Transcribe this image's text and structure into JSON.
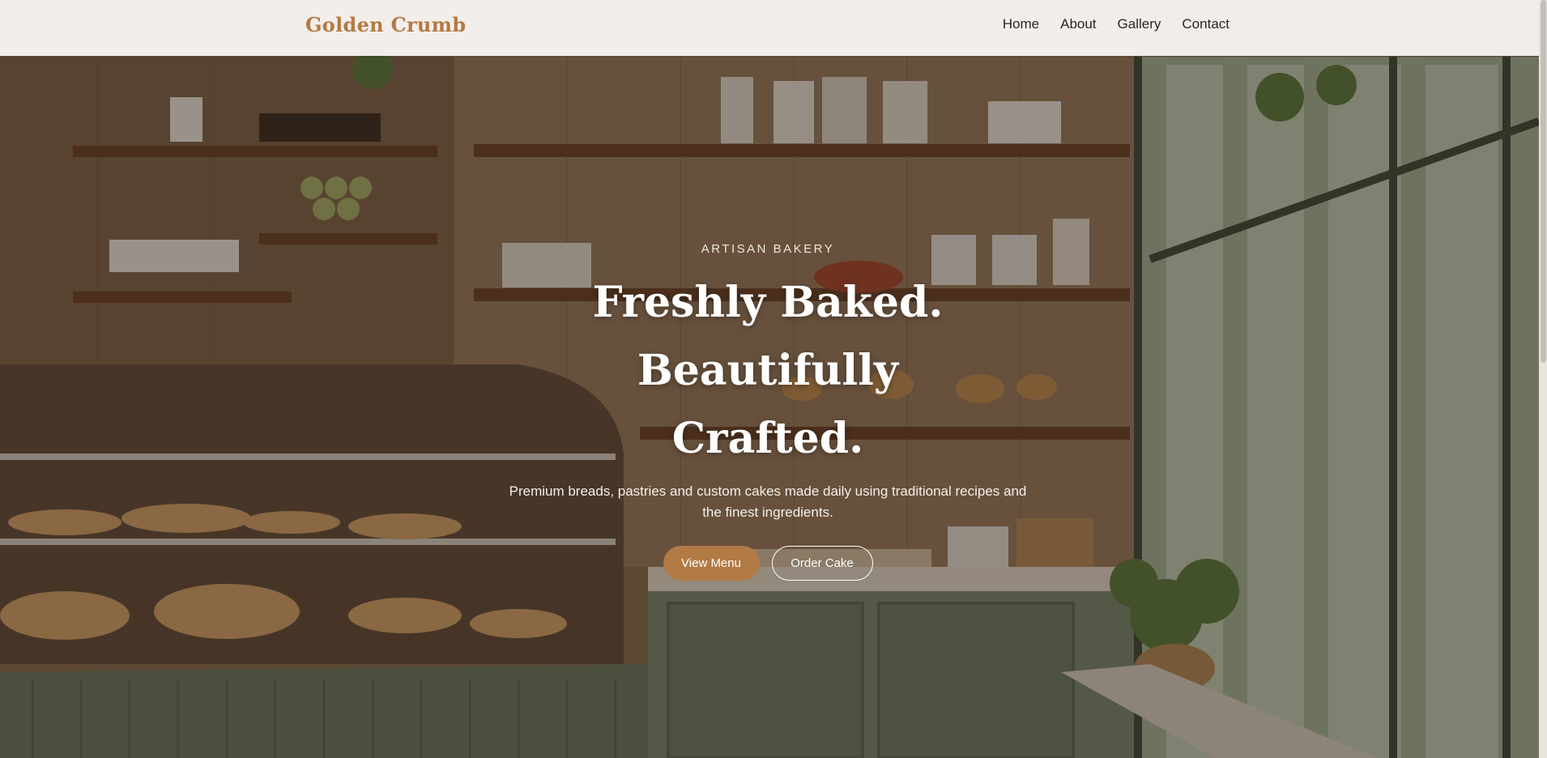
{
  "brand": {
    "name": "Golden Crumb",
    "color": "#b27a45"
  },
  "nav": {
    "items": [
      {
        "label": "Home"
      },
      {
        "label": "About"
      },
      {
        "label": "Gallery"
      },
      {
        "label": "Contact"
      }
    ]
  },
  "hero": {
    "eyebrow": "ARTISAN BAKERY",
    "title_line1": "Freshly Baked. Beautifully",
    "title_line2": "Crafted.",
    "subtitle_line1": "Premium breads, pastries and custom cakes made daily using traditional recipes and",
    "subtitle_line2": "the finest ingredients.",
    "primary_button": "View Menu",
    "secondary_button": "Order Cake",
    "background_image": "bakery-interior-illustration"
  },
  "colors": {
    "accent": "#b27a45",
    "navbar_bg": "#f6f2ee",
    "text_dark": "#2b2520"
  }
}
